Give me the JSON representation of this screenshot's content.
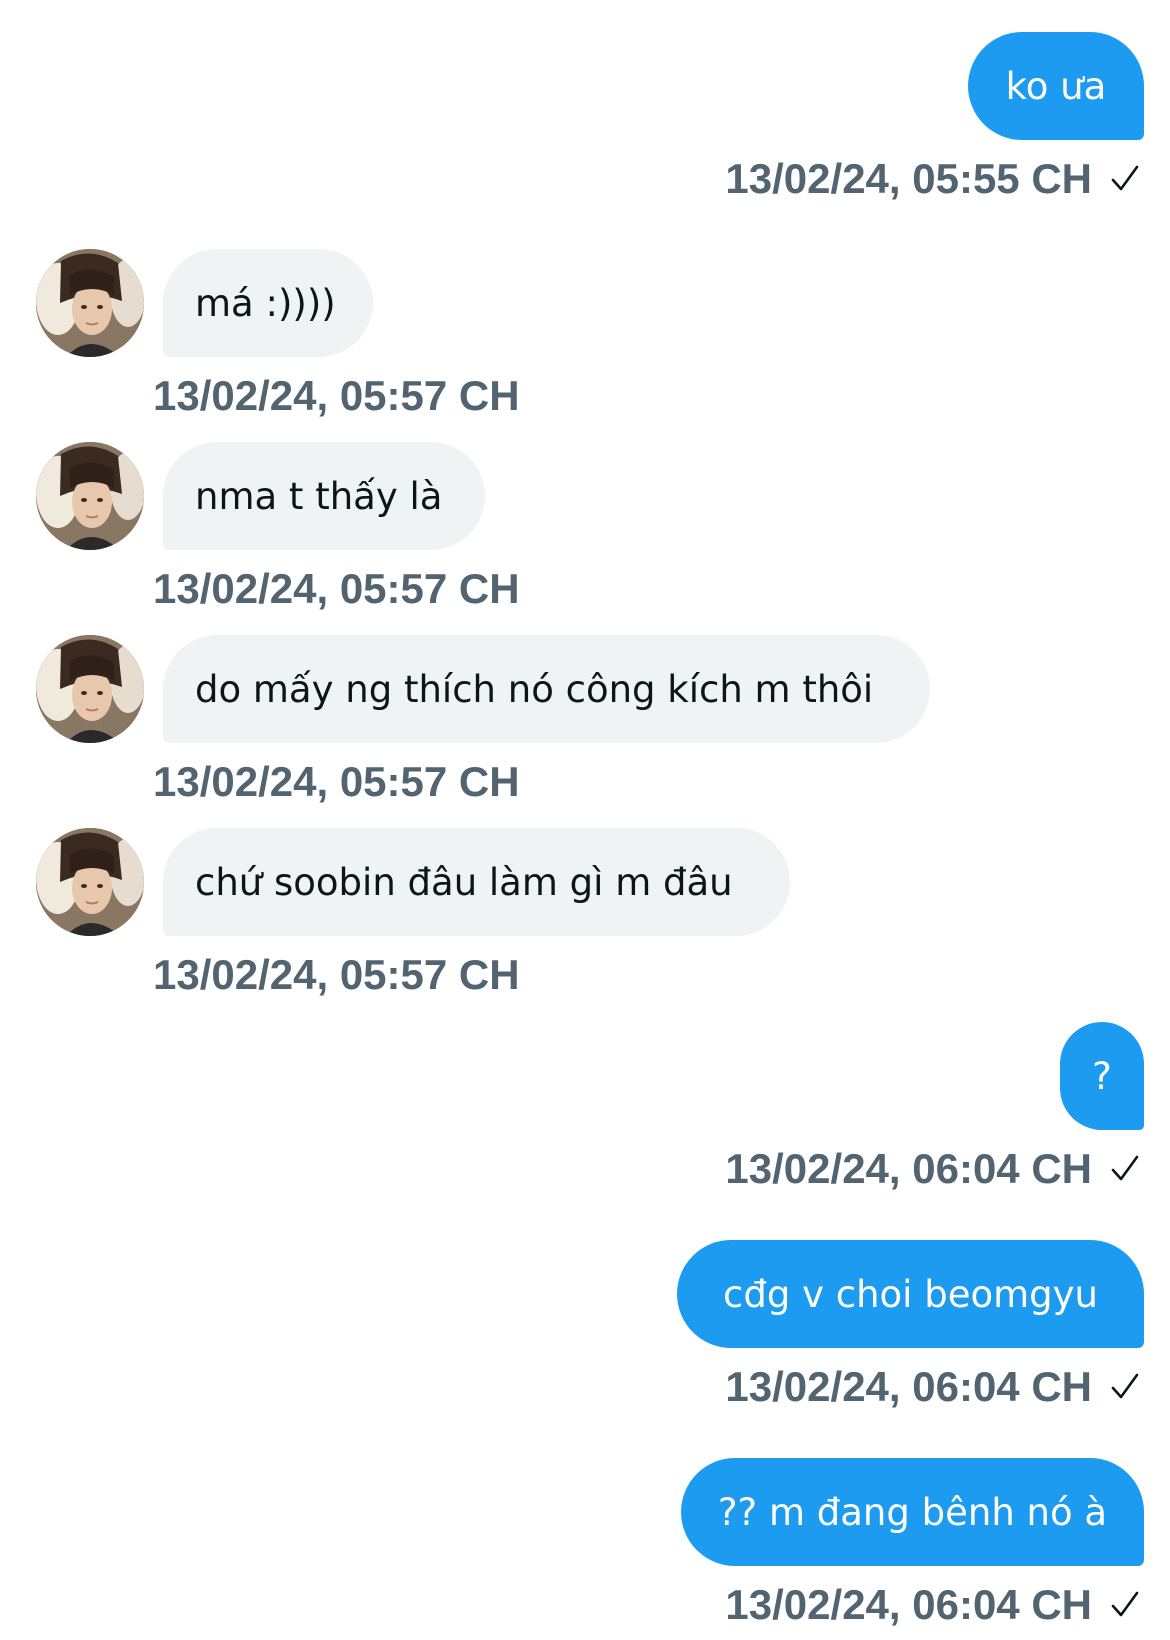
{
  "conversation": {
    "messages": [
      {
        "direction": "outgoing",
        "text": "ko ưa",
        "timestamp": "13/02/24, 05:55 CH",
        "status_icon": "sent-check-icon"
      },
      {
        "direction": "incoming",
        "text": "má :))))",
        "timestamp": "13/02/24, 05:57 CH",
        "avatar_icon": "user-avatar"
      },
      {
        "direction": "incoming",
        "text": "nma t thấy là",
        "timestamp": "13/02/24, 05:57 CH",
        "avatar_icon": "user-avatar"
      },
      {
        "direction": "incoming",
        "text": "do mấy ng thích nó công kích m thôi",
        "timestamp": "13/02/24, 05:57 CH",
        "avatar_icon": "user-avatar"
      },
      {
        "direction": "incoming",
        "text": "chứ soobin đâu làm gì m đâu",
        "timestamp": "13/02/24, 05:57 CH",
        "avatar_icon": "user-avatar"
      },
      {
        "direction": "outgoing",
        "text": "?",
        "timestamp": "13/02/24, 06:04 CH",
        "status_icon": "sent-check-icon"
      },
      {
        "direction": "outgoing",
        "text": "cđg v choi beomgyu",
        "timestamp": "13/02/24, 06:04 CH",
        "status_icon": "sent-check-icon"
      },
      {
        "direction": "outgoing",
        "text": "?? m đang bênh nó à",
        "timestamp": "13/02/24, 06:04 CH",
        "status_icon": "sent-check-icon"
      }
    ]
  },
  "colors": {
    "outgoing_bubble": "#1d9bf0",
    "incoming_bubble": "#eff3f4",
    "timestamp_text": "#536471",
    "incoming_text": "#0f1419"
  }
}
